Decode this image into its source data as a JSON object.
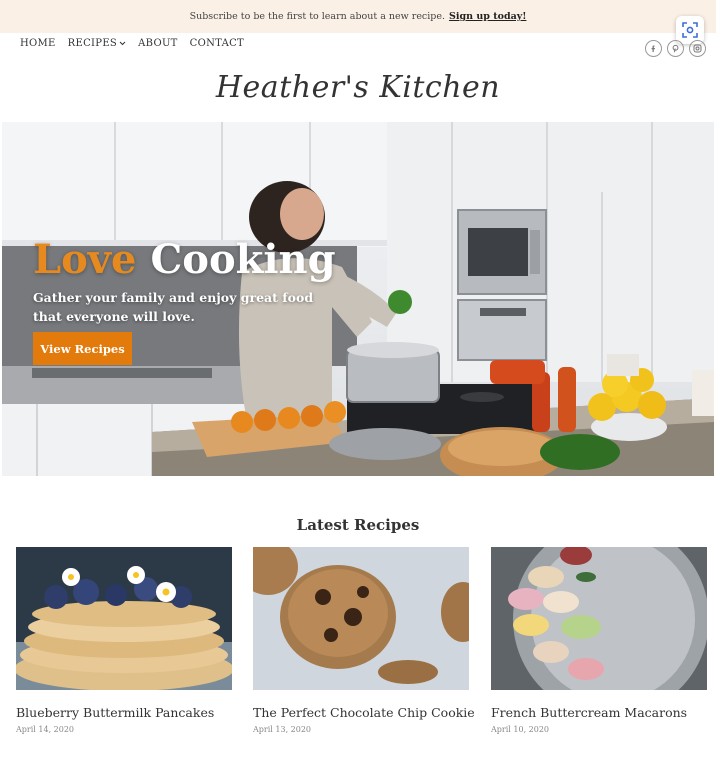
{
  "announcement": {
    "text": "Subscribe to be the first to learn about a new recipe.",
    "link": "Sign up today!"
  },
  "nav": {
    "items": [
      "Home",
      "Recipes",
      "About",
      "Contact"
    ]
  },
  "social": [
    "facebook-icon",
    "pinterest-icon",
    "instagram-icon"
  ],
  "logo": "Heather's Kitchen",
  "hero": {
    "title_accent": "Love",
    "title_rest": "Cooking",
    "subtitle": "Gather your family and enjoy great food that everyone will love.",
    "button": "View Recipes"
  },
  "latest": {
    "heading": "Latest Recipes",
    "cards": [
      {
        "title": "Blueberry Buttermilk Pancakes",
        "date": "April 14, 2020"
      },
      {
        "title": "The Perfect Chocolate Chip Cookie",
        "date": "April 13, 2020"
      },
      {
        "title": "French Buttercream Macarons",
        "date": "April 10, 2020"
      }
    ]
  },
  "colors": {
    "accent": "#e37b0c",
    "announce_bg": "#fbf0e6"
  }
}
